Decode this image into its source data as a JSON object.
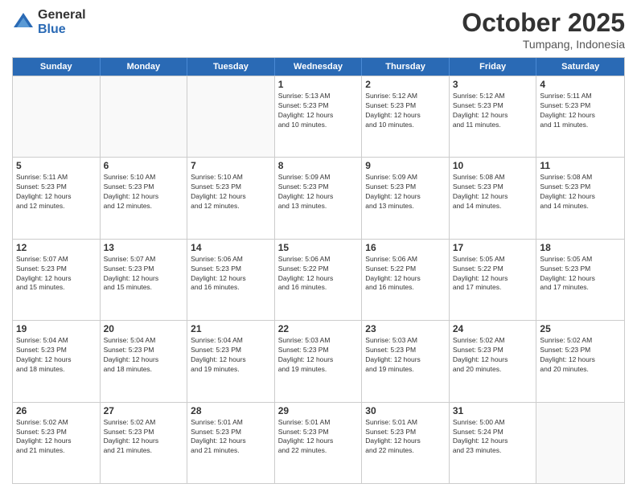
{
  "logo": {
    "general": "General",
    "blue": "Blue"
  },
  "title": "October 2025",
  "location": "Tumpang, Indonesia",
  "header_days": [
    "Sunday",
    "Monday",
    "Tuesday",
    "Wednesday",
    "Thursday",
    "Friday",
    "Saturday"
  ],
  "weeks": [
    [
      {
        "day": "",
        "info": ""
      },
      {
        "day": "",
        "info": ""
      },
      {
        "day": "",
        "info": ""
      },
      {
        "day": "1",
        "info": "Sunrise: 5:13 AM\nSunset: 5:23 PM\nDaylight: 12 hours\nand 10 minutes."
      },
      {
        "day": "2",
        "info": "Sunrise: 5:12 AM\nSunset: 5:23 PM\nDaylight: 12 hours\nand 10 minutes."
      },
      {
        "day": "3",
        "info": "Sunrise: 5:12 AM\nSunset: 5:23 PM\nDaylight: 12 hours\nand 11 minutes."
      },
      {
        "day": "4",
        "info": "Sunrise: 5:11 AM\nSunset: 5:23 PM\nDaylight: 12 hours\nand 11 minutes."
      }
    ],
    [
      {
        "day": "5",
        "info": "Sunrise: 5:11 AM\nSunset: 5:23 PM\nDaylight: 12 hours\nand 12 minutes."
      },
      {
        "day": "6",
        "info": "Sunrise: 5:10 AM\nSunset: 5:23 PM\nDaylight: 12 hours\nand 12 minutes."
      },
      {
        "day": "7",
        "info": "Sunrise: 5:10 AM\nSunset: 5:23 PM\nDaylight: 12 hours\nand 12 minutes."
      },
      {
        "day": "8",
        "info": "Sunrise: 5:09 AM\nSunset: 5:23 PM\nDaylight: 12 hours\nand 13 minutes."
      },
      {
        "day": "9",
        "info": "Sunrise: 5:09 AM\nSunset: 5:23 PM\nDaylight: 12 hours\nand 13 minutes."
      },
      {
        "day": "10",
        "info": "Sunrise: 5:08 AM\nSunset: 5:23 PM\nDaylight: 12 hours\nand 14 minutes."
      },
      {
        "day": "11",
        "info": "Sunrise: 5:08 AM\nSunset: 5:23 PM\nDaylight: 12 hours\nand 14 minutes."
      }
    ],
    [
      {
        "day": "12",
        "info": "Sunrise: 5:07 AM\nSunset: 5:23 PM\nDaylight: 12 hours\nand 15 minutes."
      },
      {
        "day": "13",
        "info": "Sunrise: 5:07 AM\nSunset: 5:23 PM\nDaylight: 12 hours\nand 15 minutes."
      },
      {
        "day": "14",
        "info": "Sunrise: 5:06 AM\nSunset: 5:23 PM\nDaylight: 12 hours\nand 16 minutes."
      },
      {
        "day": "15",
        "info": "Sunrise: 5:06 AM\nSunset: 5:22 PM\nDaylight: 12 hours\nand 16 minutes."
      },
      {
        "day": "16",
        "info": "Sunrise: 5:06 AM\nSunset: 5:22 PM\nDaylight: 12 hours\nand 16 minutes."
      },
      {
        "day": "17",
        "info": "Sunrise: 5:05 AM\nSunset: 5:22 PM\nDaylight: 12 hours\nand 17 minutes."
      },
      {
        "day": "18",
        "info": "Sunrise: 5:05 AM\nSunset: 5:23 PM\nDaylight: 12 hours\nand 17 minutes."
      }
    ],
    [
      {
        "day": "19",
        "info": "Sunrise: 5:04 AM\nSunset: 5:23 PM\nDaylight: 12 hours\nand 18 minutes."
      },
      {
        "day": "20",
        "info": "Sunrise: 5:04 AM\nSunset: 5:23 PM\nDaylight: 12 hours\nand 18 minutes."
      },
      {
        "day": "21",
        "info": "Sunrise: 5:04 AM\nSunset: 5:23 PM\nDaylight: 12 hours\nand 19 minutes."
      },
      {
        "day": "22",
        "info": "Sunrise: 5:03 AM\nSunset: 5:23 PM\nDaylight: 12 hours\nand 19 minutes."
      },
      {
        "day": "23",
        "info": "Sunrise: 5:03 AM\nSunset: 5:23 PM\nDaylight: 12 hours\nand 19 minutes."
      },
      {
        "day": "24",
        "info": "Sunrise: 5:02 AM\nSunset: 5:23 PM\nDaylight: 12 hours\nand 20 minutes."
      },
      {
        "day": "25",
        "info": "Sunrise: 5:02 AM\nSunset: 5:23 PM\nDaylight: 12 hours\nand 20 minutes."
      }
    ],
    [
      {
        "day": "26",
        "info": "Sunrise: 5:02 AM\nSunset: 5:23 PM\nDaylight: 12 hours\nand 21 minutes."
      },
      {
        "day": "27",
        "info": "Sunrise: 5:02 AM\nSunset: 5:23 PM\nDaylight: 12 hours\nand 21 minutes."
      },
      {
        "day": "28",
        "info": "Sunrise: 5:01 AM\nSunset: 5:23 PM\nDaylight: 12 hours\nand 21 minutes."
      },
      {
        "day": "29",
        "info": "Sunrise: 5:01 AM\nSunset: 5:23 PM\nDaylight: 12 hours\nand 22 minutes."
      },
      {
        "day": "30",
        "info": "Sunrise: 5:01 AM\nSunset: 5:23 PM\nDaylight: 12 hours\nand 22 minutes."
      },
      {
        "day": "31",
        "info": "Sunrise: 5:00 AM\nSunset: 5:24 PM\nDaylight: 12 hours\nand 23 minutes."
      },
      {
        "day": "",
        "info": ""
      }
    ]
  ]
}
